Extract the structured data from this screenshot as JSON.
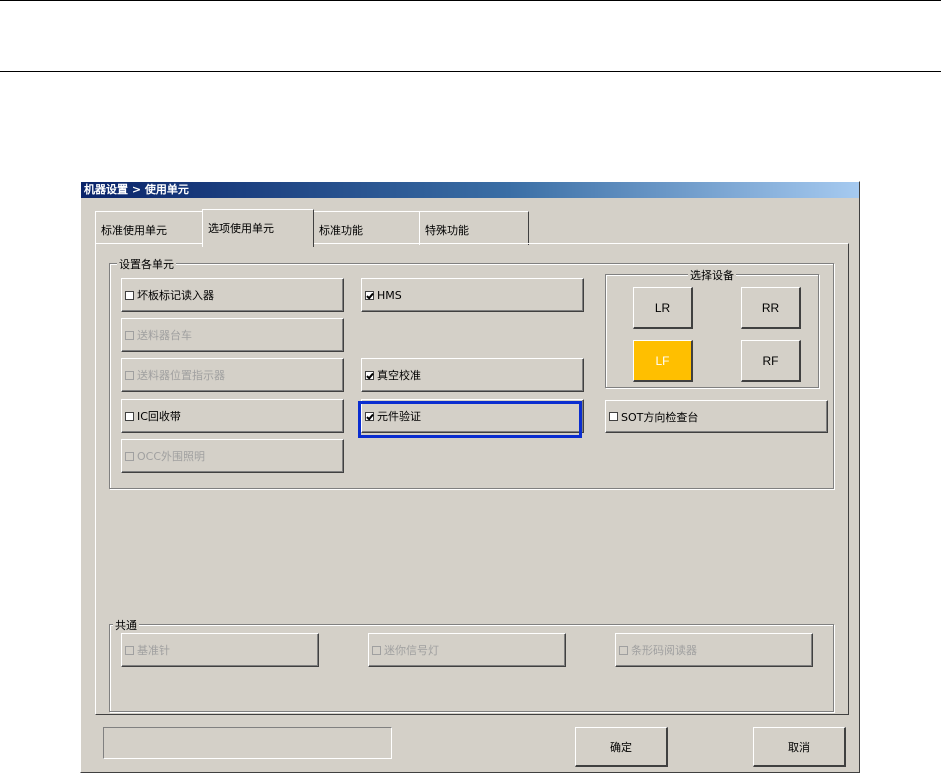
{
  "window": {
    "title": "机器设置 > 使用单元"
  },
  "tabs": [
    {
      "label": "标准使用单元",
      "active": false
    },
    {
      "label": "选项使用单元",
      "active": true
    },
    {
      "label": "标准功能",
      "active": false
    },
    {
      "label": "特殊功能",
      "active": false
    }
  ],
  "unit_group": {
    "label": "设置各单元",
    "left_column": [
      {
        "label": "坏板标记读入器",
        "checked": false,
        "enabled": true
      },
      {
        "label": "送料器台车",
        "checked": false,
        "enabled": false
      },
      {
        "label": "送料器位置指示器",
        "checked": false,
        "enabled": false
      },
      {
        "label": "IC回收带",
        "checked": false,
        "enabled": true
      },
      {
        "label": "OCC外围照明",
        "checked": false,
        "enabled": false
      }
    ],
    "middle_column": [
      {
        "label": "HMS",
        "checked": true,
        "enabled": true
      },
      {
        "label": "真空校准",
        "checked": true,
        "enabled": true
      },
      {
        "label": "元件验证",
        "checked": true,
        "enabled": true,
        "highlighted": true
      }
    ],
    "sot_option": {
      "label": "SOT方向检查台",
      "checked": false,
      "enabled": true
    }
  },
  "device_group": {
    "label": "选择设备",
    "buttons": [
      {
        "label": "LR",
        "selected": false
      },
      {
        "label": "RR",
        "selected": false
      },
      {
        "label": "LF",
        "selected": true
      },
      {
        "label": "RF",
        "selected": false
      }
    ],
    "selected_color": "#FFBF00"
  },
  "common_group": {
    "label": "共通",
    "items": [
      {
        "label": "基准针",
        "checked": false,
        "enabled": false
      },
      {
        "label": "迷你信号灯",
        "checked": false,
        "enabled": false
      },
      {
        "label": "条形码阅读器",
        "checked": false,
        "enabled": false
      }
    ]
  },
  "footer": {
    "status_text": "",
    "ok_label": "确定",
    "cancel_label": "取消"
  }
}
